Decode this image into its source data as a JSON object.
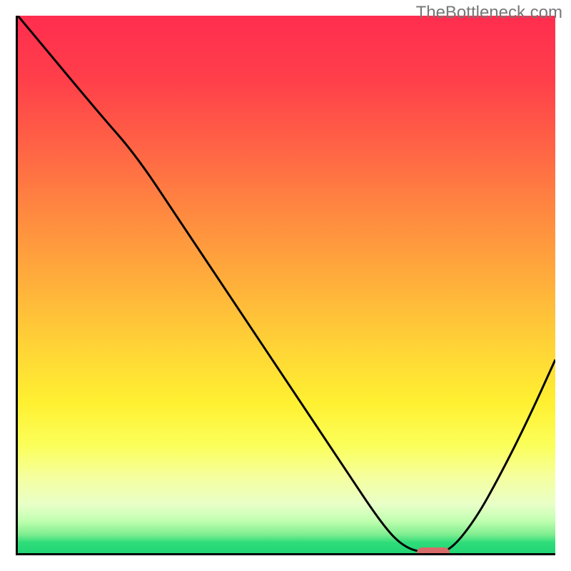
{
  "watermark": "TheBottleneck.com",
  "chart_data": {
    "type": "line",
    "title": "",
    "xlabel": "",
    "ylabel": "",
    "xlim": [
      0,
      100
    ],
    "ylim": [
      0,
      100
    ],
    "x": [
      0,
      5,
      15,
      22,
      30,
      40,
      50,
      60,
      68,
      72,
      76,
      80,
      85,
      90,
      95,
      100
    ],
    "values": [
      100,
      94,
      82,
      74,
      62,
      47,
      32,
      17,
      5,
      1,
      0,
      0,
      6,
      15,
      25,
      36
    ],
    "optimal_marker": {
      "x": 77,
      "y": 0.5,
      "width": 6,
      "height": 2
    },
    "gradient": {
      "top": "#ff2d4f",
      "mid": "#ffd536",
      "bottom": "#20d574"
    }
  }
}
